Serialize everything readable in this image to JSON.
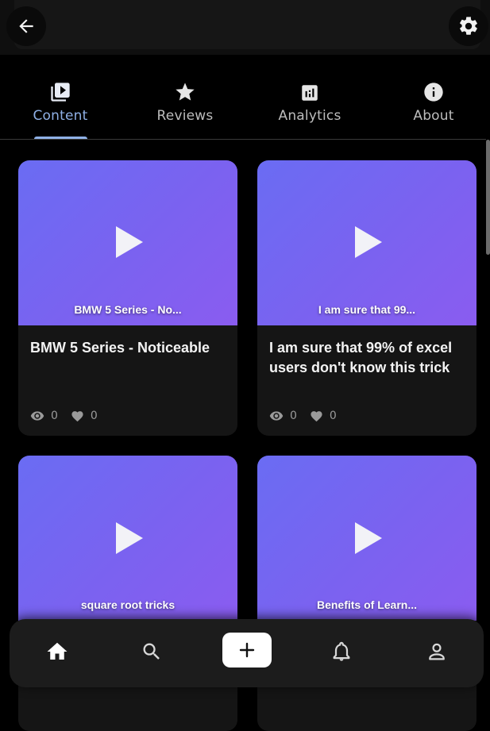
{
  "tabs": [
    {
      "label": "Content",
      "icon": "video-library-icon",
      "active": true
    },
    {
      "label": "Reviews",
      "icon": "star-icon",
      "active": false
    },
    {
      "label": "Analytics",
      "icon": "analytics-icon",
      "active": false
    },
    {
      "label": "About",
      "icon": "info-icon",
      "active": false
    }
  ],
  "cards": [
    {
      "thumb_caption": "BMW 5 Series - No...",
      "title": "BMW 5 Series - Noticeable",
      "views": "0",
      "likes": "0"
    },
    {
      "thumb_caption": "I am sure that 99...",
      "title": "I am sure that 99% of excel users don't know this trick",
      "views": "0",
      "likes": "0"
    },
    {
      "thumb_caption": "square root tricks",
      "title": "",
      "views": "",
      "likes": ""
    },
    {
      "thumb_caption": "Benefits of Learn...",
      "title": "",
      "views": "",
      "likes": ""
    }
  ],
  "nav": {
    "items": [
      "home-icon",
      "search-icon",
      "add-icon",
      "notifications-icon",
      "profile-icon"
    ]
  },
  "colors": {
    "accent": "#8fb0e6",
    "thumb_gradient_start": "#6a6cf3",
    "thumb_gradient_end": "#8a5cf0",
    "background": "#000000"
  }
}
